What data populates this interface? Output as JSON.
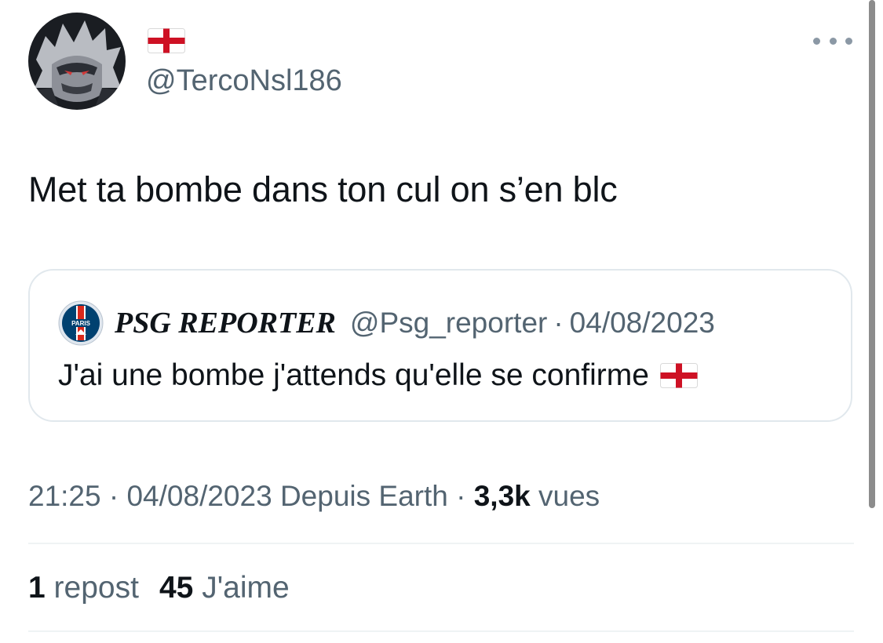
{
  "author": {
    "display_name_icon": "england-flag-icon",
    "handle": "@TercoNsl186",
    "avatar_icon": "masked-character-avatar"
  },
  "more_menu_icon": "more-horizontal-icon",
  "tweet": {
    "text": "Met ta bombe dans ton cul on s’en blc"
  },
  "quoted_tweet": {
    "logo_icon": "psg-logo-icon",
    "logo_text": "PARIS",
    "name": "PSG REPORTER",
    "handle": "@Psg_reporter",
    "separator": "·",
    "date": "04/08/2023",
    "text": "J'ai une bombe j'attends qu'elle se confirme",
    "trailing_icon": "england-flag-icon"
  },
  "meta": {
    "time": "21:25",
    "separator": "·",
    "date": "04/08/2023",
    "source": "Depuis Earth",
    "views_count": "3,3k",
    "views_label": "vues"
  },
  "stats": {
    "reposts_count": "1",
    "reposts_label": "repost",
    "likes_count": "45",
    "likes_label": "J'aime"
  },
  "colors": {
    "text_primary": "#0f1419",
    "text_secondary": "#536471",
    "border": "#e1e8ed",
    "flag_red": "#ce1124",
    "psg_blue": "#004170",
    "psg_red": "#da291c"
  }
}
